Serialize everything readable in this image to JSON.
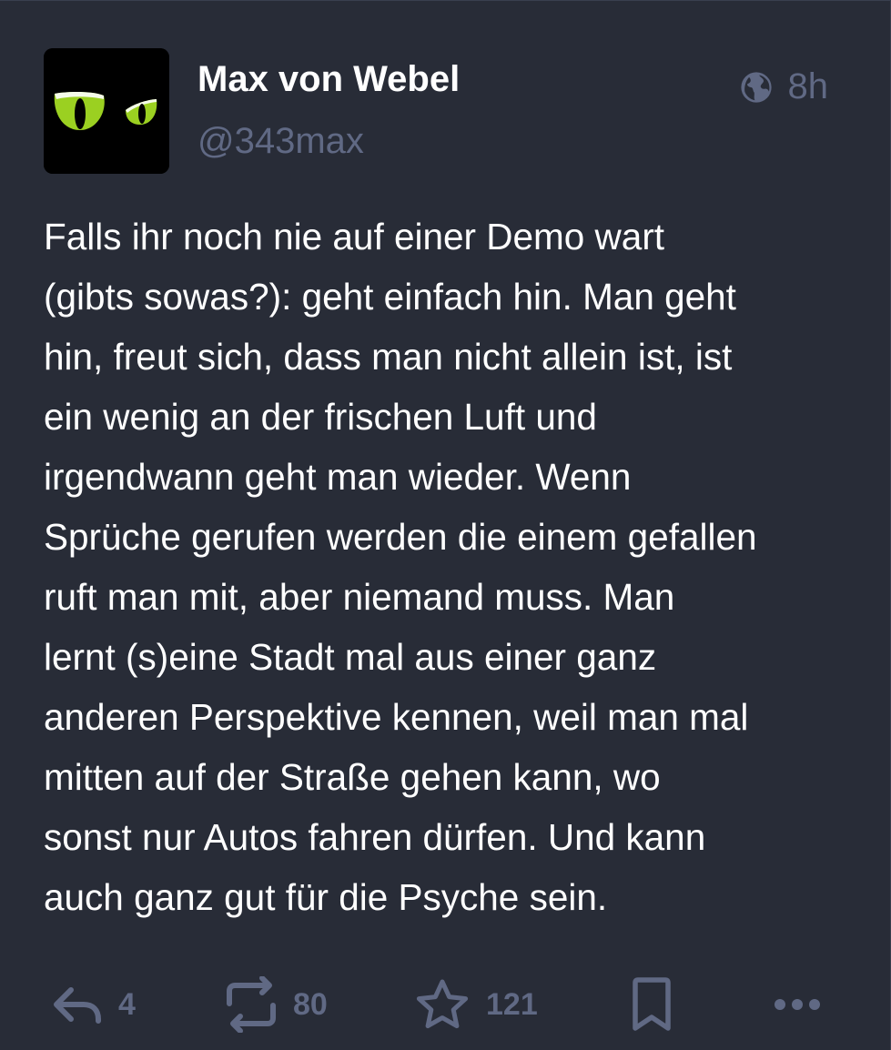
{
  "status": {
    "author": {
      "display_name": "Max von Webel",
      "handle": "@343max"
    },
    "visibility_icon": "globe-icon",
    "time": "8h",
    "content": "Falls ihr noch nie auf einer Demo wart\n(gibts sowas?): geht einfach hin. Man geht\nhin, freut sich, dass man nicht allein ist, ist\nein wenig an der frischen Luft und\nirgendwann geht man wieder. Wenn\nSprüche gerufen werden die einem gefallen\nruft man mit, aber niemand muss. Man\nlernt (s)eine Stadt mal aus einer ganz\nanderen Perspektive kennen, weil man mal\nmitten auf der Straße gehen kann, wo\nsonst nur Autos fahren dürfen. Und kann\nauch ganz gut für die Psyche sein.",
    "actions": {
      "reply": {
        "icon": "reply-icon",
        "count": "4"
      },
      "boost": {
        "icon": "boost-icon",
        "count": "80"
      },
      "favourite": {
        "icon": "star-icon",
        "count": "121"
      },
      "bookmark": {
        "icon": "bookmark-icon"
      },
      "more": {
        "icon": "more-icon"
      }
    }
  },
  "colors": {
    "background": "#282c37",
    "text": "#ffffff",
    "muted": "#606984",
    "avatar_eye": "#9bd021"
  }
}
